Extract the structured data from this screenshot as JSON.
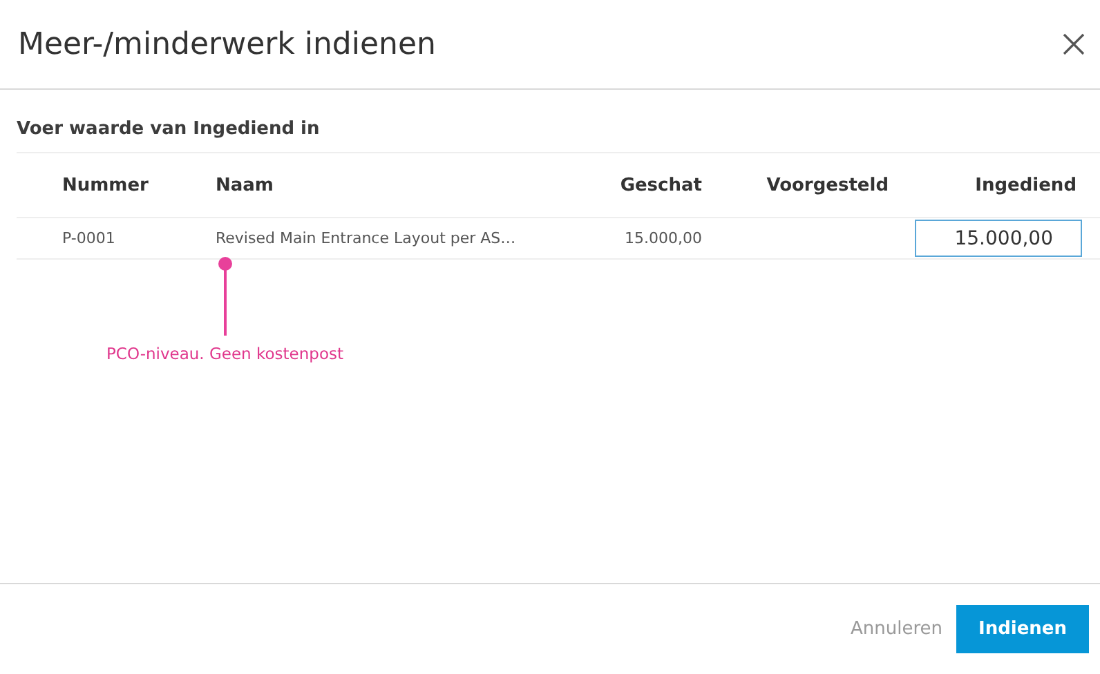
{
  "dialog": {
    "title": "Meer-/minderwerk indienen"
  },
  "instruction": "Voer waarde van Ingediend in",
  "table": {
    "columns": [
      "Nummer",
      "Naam",
      "Geschat",
      "Voorgesteld",
      "Ingediend"
    ],
    "rows": [
      {
        "nummer": "P-0001",
        "naam": "Revised Main Entrance Layout per AS…",
        "geschat": "15.000,00",
        "voorgesteld": "",
        "ingediend": "15.000,00"
      }
    ]
  },
  "annotation": "PCO-niveau. Geen kostenpost",
  "buttons": [
    {
      "label": "Annuleren",
      "kind": "secondary"
    },
    {
      "label": "Indienen",
      "kind": "primary"
    }
  ]
}
